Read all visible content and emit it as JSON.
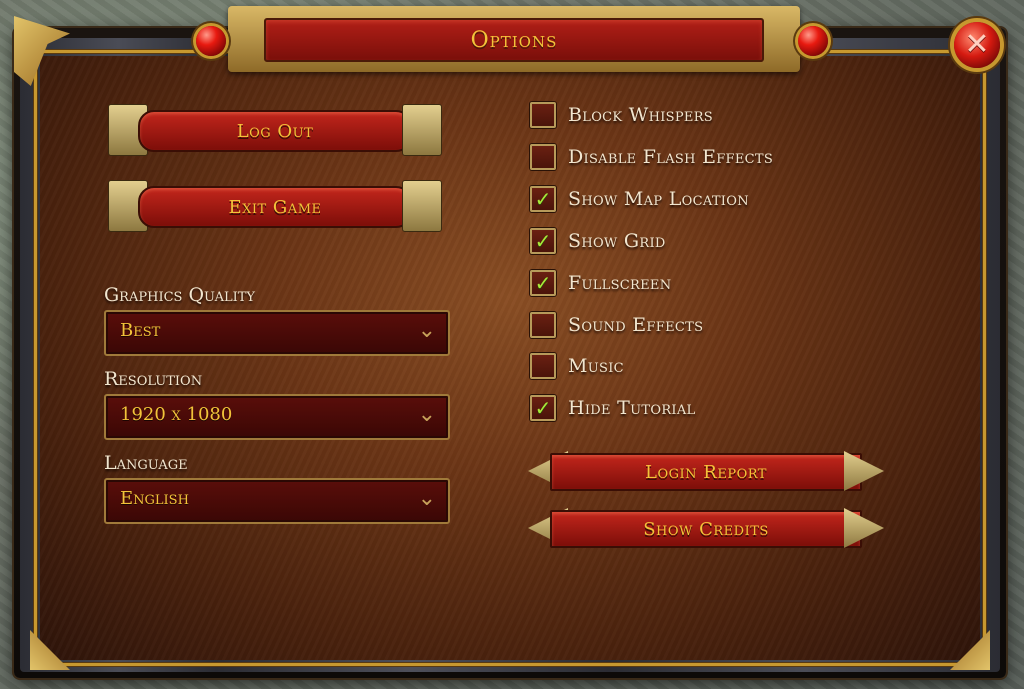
{
  "header": {
    "title": "Options"
  },
  "buttons": {
    "logout": "Log Out",
    "exit_game": "Exit Game",
    "login_report": "Login Report",
    "show_credits": "Show Credits"
  },
  "settings": {
    "graphics_quality": {
      "label": "Graphics Quality",
      "value": "Best"
    },
    "resolution": {
      "label": "Resolution",
      "value": "1920 x 1080"
    },
    "language": {
      "label": "Language",
      "value": "English"
    }
  },
  "checkboxes": [
    {
      "label": "Block Whispers",
      "checked": false
    },
    {
      "label": "Disable Flash Effects",
      "checked": false
    },
    {
      "label": "Show Map Location",
      "checked": true
    },
    {
      "label": "Show Grid",
      "checked": true
    },
    {
      "label": "Fullscreen",
      "checked": true
    },
    {
      "label": "Sound Effects",
      "checked": false
    },
    {
      "label": "Music",
      "checked": false
    },
    {
      "label": "Hide Tutorial",
      "checked": true
    }
  ],
  "icons": {
    "close": "close-icon",
    "chevron": "chevron-down-icon",
    "check": "checkmark-icon"
  },
  "colors": {
    "accent_gold": "#f3c33a",
    "button_red": "#c2261c",
    "check_green": "#a8e83a",
    "label_text": "#f2e6cf"
  }
}
